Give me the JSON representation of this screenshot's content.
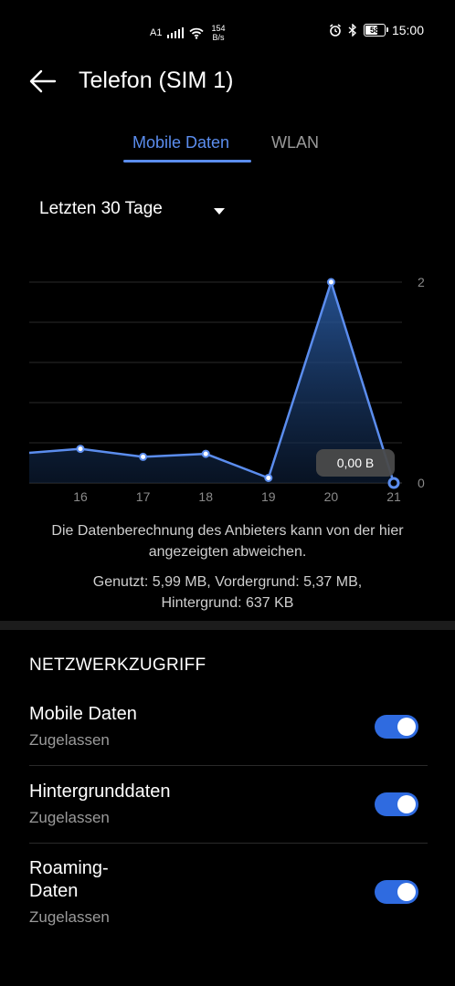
{
  "status_bar": {
    "carrier": "A1",
    "speed_value": "154",
    "speed_unit": "B/s",
    "battery": "58",
    "time": "15:00",
    "icons": [
      "signal-icon",
      "wifi-icon",
      "alarm-icon",
      "bluetooth-icon",
      "battery-icon"
    ]
  },
  "header": {
    "title": "Telefon (SIM 1)",
    "back_icon": "arrow-left-icon"
  },
  "tabs": {
    "active": "Mobile Daten",
    "inactive": "WLAN",
    "accent": "#5b8dee"
  },
  "period": {
    "label": "Letzten 30 Tage",
    "caret_icon": "caret-down-icon"
  },
  "chart_data": {
    "type": "area",
    "x": [
      "15",
      "16",
      "17",
      "18",
      "19",
      "20",
      "21"
    ],
    "tick_labels": [
      "16",
      "17",
      "18",
      "19",
      "20",
      "21"
    ],
    "values": [
      0.3,
      0.34,
      0.26,
      0.29,
      0.05,
      2.0,
      0.0
    ],
    "ylim": [
      0,
      2
    ],
    "y_tick_labels": [
      "2",
      "0"
    ],
    "tooltip": "0,00 B",
    "grid": true,
    "line_color": "#5b8dee"
  },
  "notes": {
    "disclaimer": "Die Datenberechnung des Anbieters kann von der hier angezeigten abweichen.",
    "usage": "Genutzt: 5,99 MB, Vordergrund: 5,37 MB, Hintergrund: 637 KB"
  },
  "section": {
    "title": "NETZWERKZUGRIFF"
  },
  "settings": [
    {
      "label": "Mobile Daten",
      "sub": "Zugelassen",
      "enabled": true
    },
    {
      "label": "Hintergrunddaten",
      "sub": "Zugelassen",
      "enabled": true
    },
    {
      "label": "Roaming-Daten",
      "label_line1": "Roaming-",
      "label_line2": "Daten",
      "sub": "Zugelassen",
      "enabled": true
    }
  ],
  "colors": {
    "toggle_on": "#2f6be0",
    "background": "#000000"
  }
}
